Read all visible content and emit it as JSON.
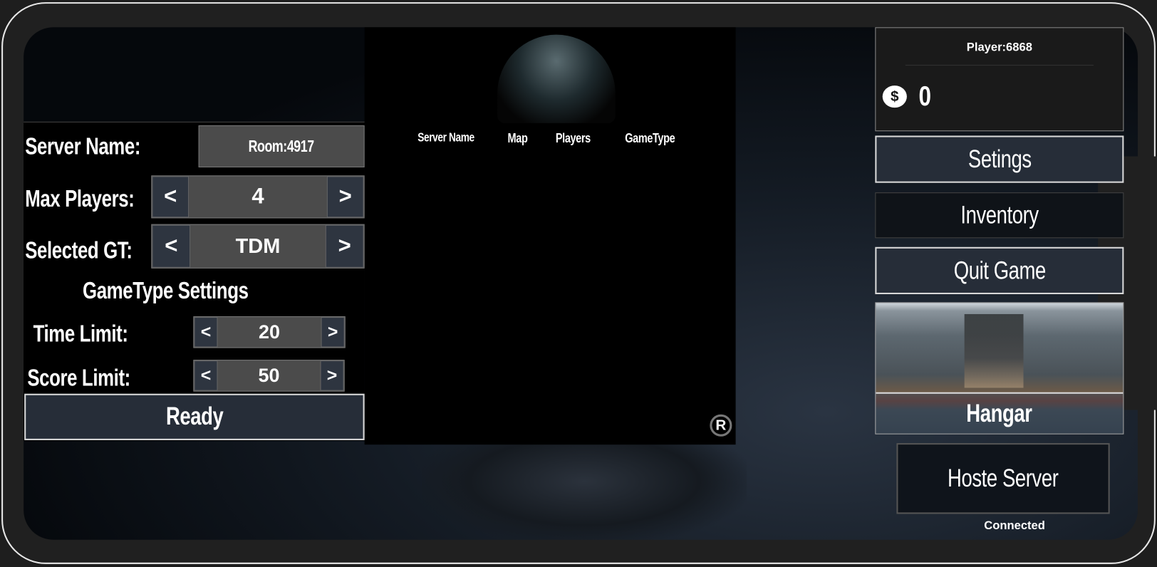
{
  "host_panel": {
    "server_name_label": "Server Name:",
    "server_name_value": "Room:4917",
    "max_players_label": "Max Players:",
    "max_players_value": "4",
    "selected_gt_label": "Selected GT:",
    "selected_gt_value": "TDM",
    "gametype_settings_title": "GameType Settings",
    "time_limit_label": "Time Limit:",
    "time_limit_value": "20",
    "score_limit_label": "Score Limit:",
    "score_limit_value": "50",
    "prev_arrow": "<",
    "next_arrow": ">",
    "ready_label": "Ready"
  },
  "server_list": {
    "columns": [
      "Server Name",
      "Map",
      "Players",
      "GameType"
    ],
    "refresh_icon_letter": "R"
  },
  "profile": {
    "player_name": "Player:6868",
    "currency_symbol": "$",
    "coins": "0"
  },
  "menu": {
    "settings": "Setings",
    "inventory": "Inventory",
    "quit": "Quit Game"
  },
  "map": {
    "name": "Hangar"
  },
  "host_button": "Hoste Server",
  "status": "Connected"
}
